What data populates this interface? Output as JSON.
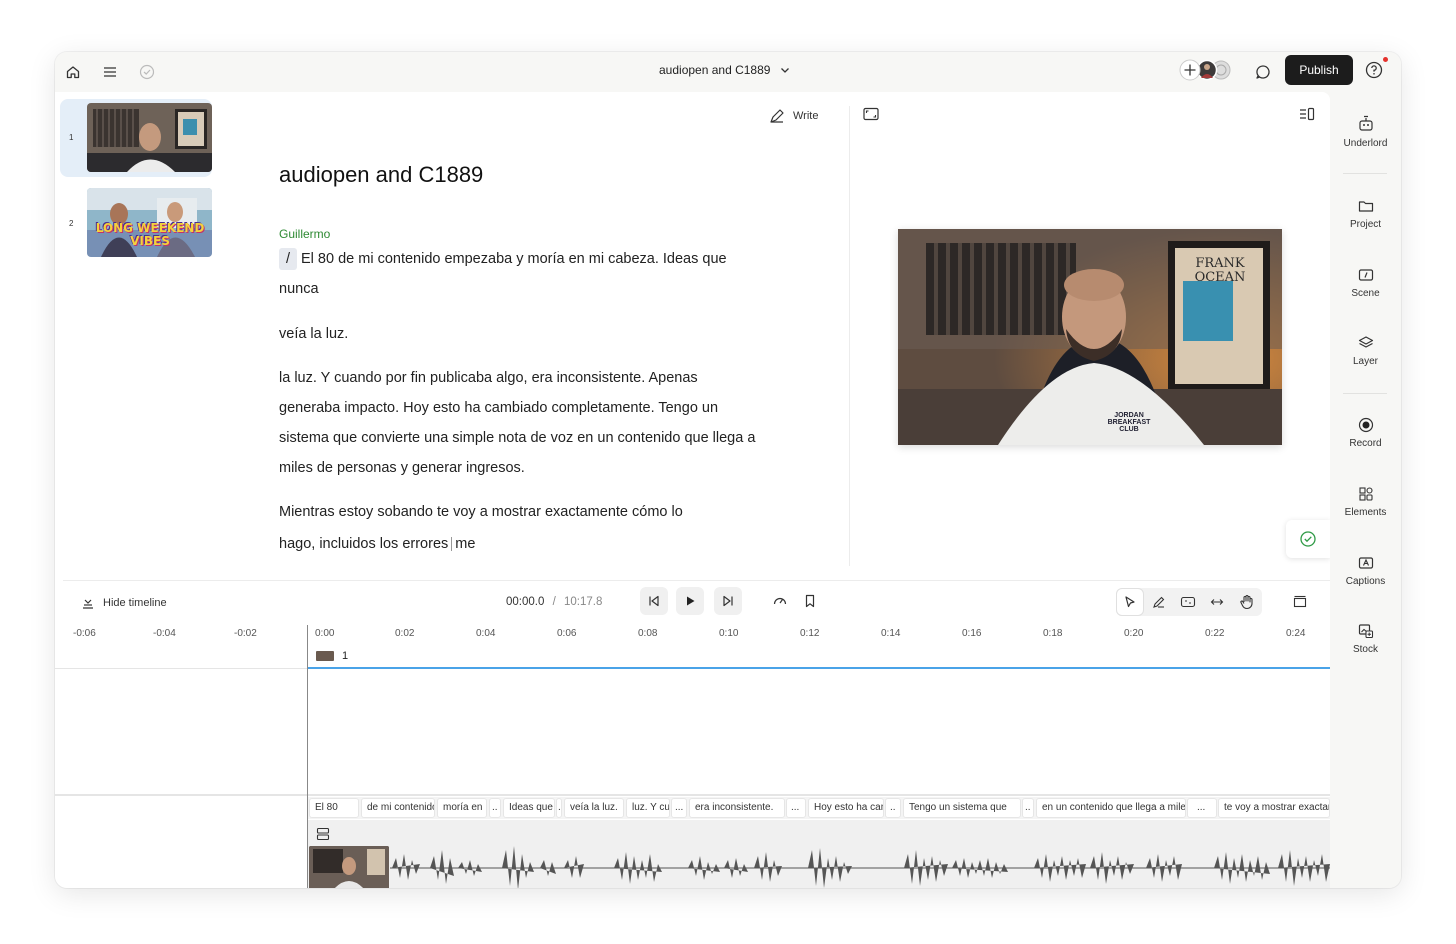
{
  "topbar": {
    "doc_title": "audiopen and C1889",
    "publish_label": "Publish"
  },
  "rightbar": {
    "items": [
      {
        "label": "Underlord",
        "icon": "robot-icon"
      },
      {
        "label": "Project",
        "icon": "folder-icon"
      },
      {
        "label": "Scene",
        "icon": "scene-icon"
      },
      {
        "label": "Layer",
        "icon": "layers-icon"
      },
      {
        "label": "Record",
        "icon": "record-icon"
      },
      {
        "label": "Elements",
        "icon": "elements-icon"
      },
      {
        "label": "Captions",
        "icon": "captions-icon"
      },
      {
        "label": "Stock",
        "icon": "stock-icon"
      }
    ]
  },
  "scenes": [
    {
      "number": "1",
      "selected": true
    },
    {
      "number": "2",
      "selected": false,
      "overlay_text": "LONG WEEKEND VIBES"
    }
  ],
  "editor": {
    "write_label": "Write",
    "title": "audiopen and C1889",
    "speaker": "Guillermo",
    "cursor_glyph": "/",
    "p1_line1": "El 80 de mi contenido empezaba y moría en mi cabeza. Ideas que",
    "p1_line2": "nunca",
    "p2": "veía la luz.",
    "p3": "la luz. Y cuando por fin publicaba algo, era inconsistente. Apenas generaba impacto. Hoy esto ha cambiado completamente. Tengo un sistema que convierte una simple nota de voz en un contenido que llega a miles de personas y generar ingresos.",
    "p4_line1": "Mientras estoy sobando te voy a mostrar exactamente cómo lo",
    "p4_line2a": "hago, incluidos los errores",
    "p4_line2b": "me"
  },
  "video_preview": {
    "shirt_text": "JORDAN BREAKFAST CLUB",
    "poster_text": "FRANK OCEAN"
  },
  "timeline": {
    "hide_label": "Hide timeline",
    "current_time": "00:00.0",
    "separator": "/",
    "total_time": "10:17.8",
    "ticks": [
      "-0:06",
      "-0:04",
      "-0:02",
      "0:00",
      "0:02",
      "0:04",
      "0:06",
      "0:08",
      "0:10",
      "0:12",
      "0:14",
      "0:16",
      "0:18",
      "0:20",
      "0:22",
      "0:24"
    ],
    "scene_label": "1",
    "words": [
      "El 80",
      "de mi contenido",
      "moría en",
      "..",
      "Ideas que",
      "..",
      "veía la luz.",
      "luz. Y cuando",
      "...",
      "era inconsistente.",
      "...",
      "Hoy esto ha cambiado",
      "..",
      "Tengo un sistema que",
      "..",
      "en un contenido que llega a miles",
      "...",
      "te voy a mostrar exactamente"
    ]
  },
  "colors": {
    "speaker": "#2e8a33",
    "publish_bg": "#1c1c1c",
    "scene_line": "#4aa3e8",
    "notification": "#e5322d"
  }
}
